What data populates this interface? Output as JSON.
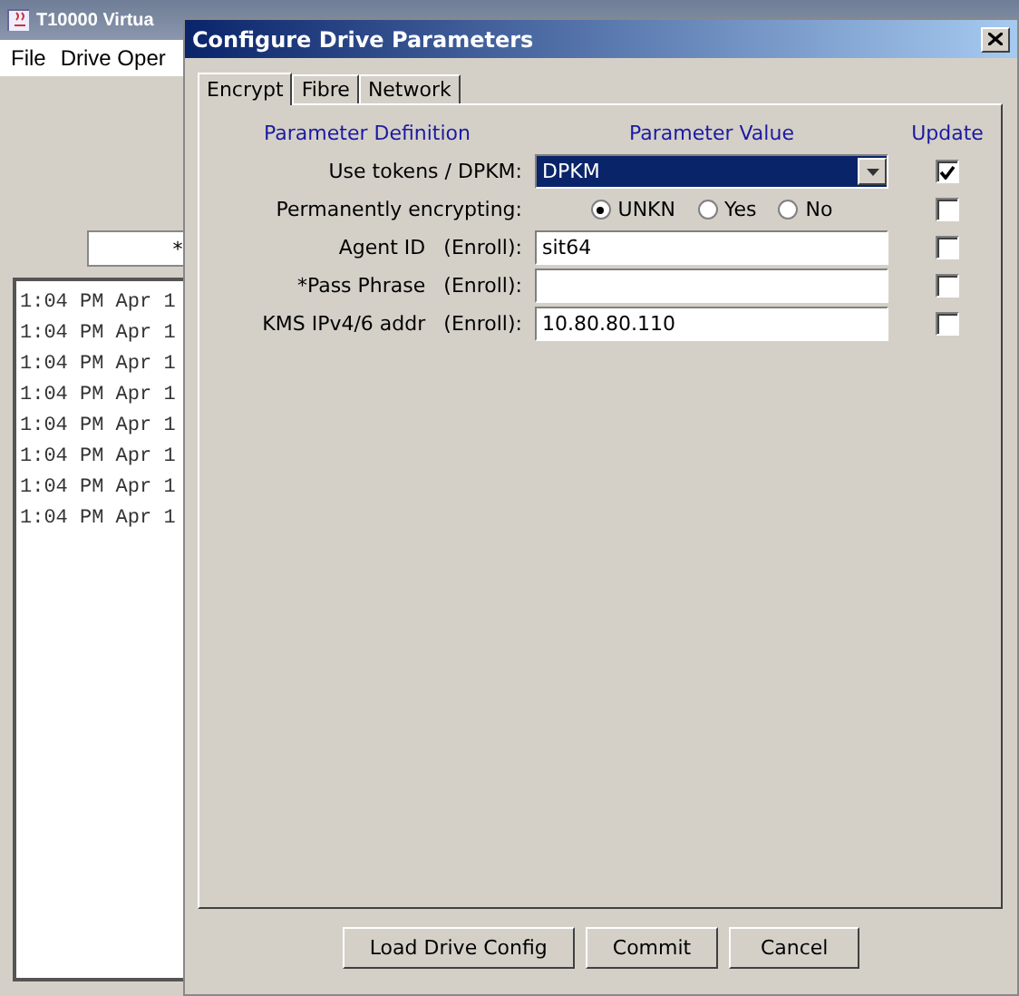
{
  "background_window": {
    "title": "T10000 Virtua",
    "menu": [
      "File",
      "Drive Oper"
    ],
    "field_value": "*",
    "log": [
      "1:04 PM Apr 1",
      "1:04 PM Apr 1",
      "1:04 PM Apr 1",
      "1:04 PM Apr 1",
      "1:04 PM Apr 1",
      "1:04 PM Apr 1",
      "1:04 PM Apr 1",
      "1:04 PM Apr 1"
    ]
  },
  "dialog": {
    "title": "Configure Drive Parameters",
    "tabs": [
      {
        "label": "Encrypt",
        "selected": true
      },
      {
        "label": "Fibre",
        "selected": false
      },
      {
        "label": "Network",
        "selected": false
      }
    ],
    "columns": [
      "Parameter Definition",
      "Parameter Value",
      "Update"
    ],
    "rows": [
      {
        "kind": "dropdown",
        "label": "Use tokens / DPKM:",
        "value": "DPKM",
        "update": true
      },
      {
        "kind": "radio",
        "label": "Permanently encrypting:",
        "options": [
          {
            "label": "UNKN",
            "selected": true
          },
          {
            "label": "Yes",
            "selected": false
          },
          {
            "label": "No",
            "selected": false
          }
        ],
        "update": false
      },
      {
        "kind": "text",
        "label": "Agent ID",
        "suffix": "(Enroll):",
        "value": "sit64",
        "update": false
      },
      {
        "kind": "text",
        "label": "*Pass Phrase",
        "suffix": "(Enroll):",
        "update": false
      },
      {
        "kind": "text",
        "label": "KMS IPv4/6 addr",
        "suffix": "(Enroll):",
        "value": "10.80.80.110",
        "update": false
      }
    ],
    "buttons": [
      "Load Drive Config",
      "Commit",
      "Cancel"
    ]
  }
}
